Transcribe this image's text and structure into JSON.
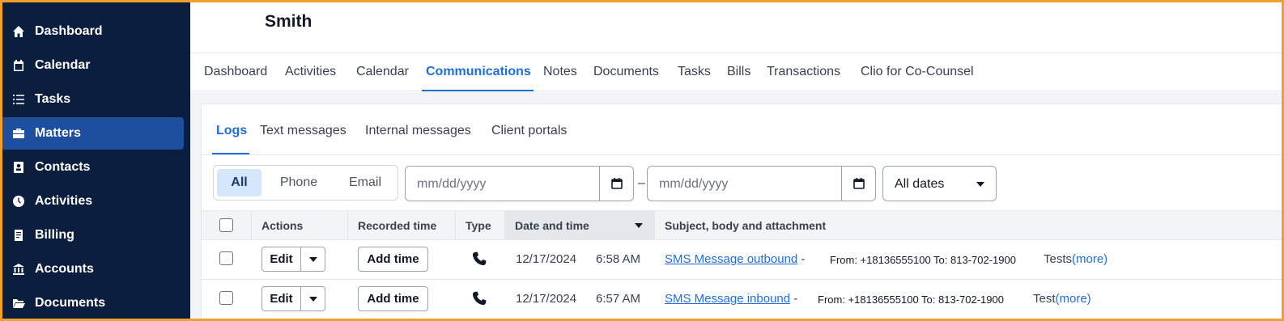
{
  "sidebar": {
    "items": [
      {
        "label": "Dashboard",
        "icon": "home-icon",
        "active": false
      },
      {
        "label": "Calendar",
        "icon": "calendar-icon",
        "active": false
      },
      {
        "label": "Tasks",
        "icon": "list-icon",
        "active": false
      },
      {
        "label": "Matters",
        "icon": "briefcase-icon",
        "active": true
      },
      {
        "label": "Contacts",
        "icon": "contact-card-icon",
        "active": false
      },
      {
        "label": "Activities",
        "icon": "clock-icon",
        "active": false
      },
      {
        "label": "Billing",
        "icon": "receipt-icon",
        "active": false
      },
      {
        "label": "Accounts",
        "icon": "bank-icon",
        "active": false
      },
      {
        "label": "Documents",
        "icon": "folder-icon",
        "active": false
      }
    ]
  },
  "matter": {
    "title": "Smith"
  },
  "matter_tabs": [
    {
      "label": "Dashboard"
    },
    {
      "label": "Activities"
    },
    {
      "label": "Calendar"
    },
    {
      "label": "Communications",
      "active": true
    },
    {
      "label": "Notes"
    },
    {
      "label": "Documents"
    },
    {
      "label": "Tasks"
    },
    {
      "label": "Bills"
    },
    {
      "label": "Transactions"
    },
    {
      "label": "Clio for Co-Counsel"
    }
  ],
  "comm_tabs": [
    {
      "label": "Logs",
      "active": true
    },
    {
      "label": "Text messages"
    },
    {
      "label": "Internal messages"
    },
    {
      "label": "Client portals"
    }
  ],
  "filters": {
    "type_options": [
      {
        "label": "All",
        "active": true
      },
      {
        "label": "Phone"
      },
      {
        "label": "Email"
      }
    ],
    "date_from_placeholder": "mm/dd/yyyy",
    "date_to_placeholder": "mm/dd/yyyy",
    "range_separator": "–",
    "date_range_select": "All dates"
  },
  "table": {
    "columns": [
      "Actions",
      "Recorded time",
      "Type",
      "Date and time",
      "Subject, body and attachment"
    ],
    "rows": [
      {
        "edit_label": "Edit",
        "add_time_label": "Add time",
        "type_icon": "phone-icon",
        "date": "12/17/2024",
        "time": "6:58 AM",
        "subject": "SMS Message outbound",
        "sep": " -",
        "details": "From: +18136555100 To: 813-702-1900",
        "body": "Tests",
        "more": "(more)"
      },
      {
        "edit_label": "Edit",
        "add_time_label": "Add time",
        "type_icon": "phone-icon",
        "date": "12/17/2024",
        "time": "6:57 AM",
        "subject": "SMS Message inbound",
        "sep": " -",
        "details": "From: +18136555100 To: 813-702-1900",
        "body": "Test",
        "more": "(more)"
      }
    ]
  },
  "colors": {
    "sidebar_bg": "#0b1e3d",
    "sidebar_active": "#1d4f9e",
    "accent": "#1e6fd9",
    "frame_border": "#f0a030"
  }
}
